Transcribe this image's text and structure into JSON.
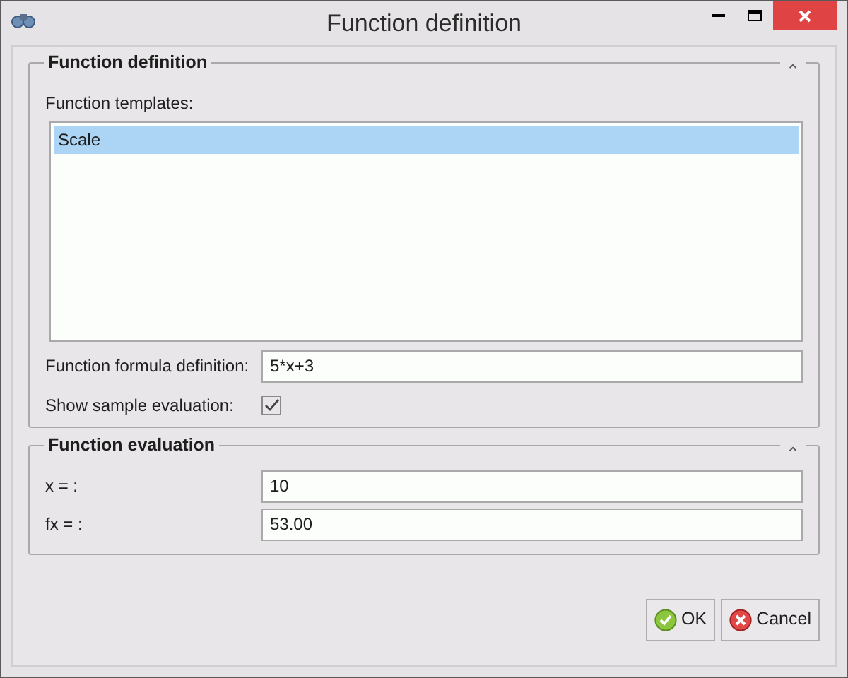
{
  "window": {
    "title": "Function definition"
  },
  "definition": {
    "title": "Function definition",
    "templates_label": "Function templates:",
    "templates": [
      {
        "label": "Scale",
        "selected": true
      }
    ],
    "formula": {
      "label": "Function formula definition:",
      "value": "5*x+3"
    },
    "show_sample": {
      "label": "Show sample evaluation:",
      "checked": true
    }
  },
  "evaluation": {
    "title": "Function evaluation",
    "fields": [
      {
        "label": "x = :",
        "value": "10"
      },
      {
        "label": "fx = :",
        "value": "53.00"
      }
    ]
  },
  "buttons": [
    {
      "label": "OK",
      "kind": "ok"
    },
    {
      "label": "Cancel",
      "kind": "cancel"
    }
  ]
}
